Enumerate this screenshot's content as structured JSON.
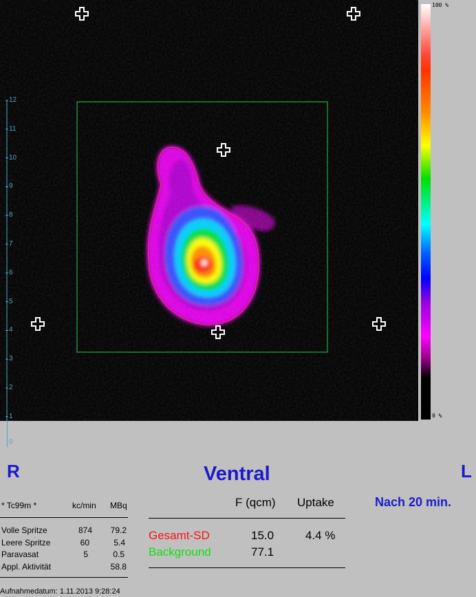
{
  "view": {
    "label": "Ventral",
    "left_label": "R",
    "right_label": "L",
    "time_note": "Nach 20 min."
  },
  "colorbar": {
    "top_label": "100 %",
    "bottom_label": "0 %"
  },
  "axis": {
    "ticks": [
      "12",
      "11",
      "10",
      "9",
      "8",
      "7",
      "6",
      "5",
      "4",
      "3",
      "2",
      "1",
      "0"
    ]
  },
  "activity_table": {
    "header": {
      "isotope": "*  Tc99m  *",
      "col1": "kc/min",
      "col2": "MBq"
    },
    "rows": [
      {
        "label": "Volle Spritze",
        "kcmin": "874",
        "mbq": "79.2"
      },
      {
        "label": "Leere Spritze",
        "kcmin": "60",
        "mbq": "5.4"
      },
      {
        "label": "Paravasat",
        "kcmin": "5",
        "mbq": "0.5"
      },
      {
        "label": "Appl. Aktivität",
        "kcmin": "",
        "mbq": "58.8"
      }
    ],
    "date_line": "Aufnahmedatum:  1.11.2013   9:28:24"
  },
  "roi_table": {
    "header": {
      "area": "F (qcm)",
      "uptake": "Uptake"
    },
    "rows": [
      {
        "label": "Gesamt-SD",
        "area": "15.0",
        "uptake": "4.4 %",
        "color": "#ff1010"
      },
      {
        "label": "Background",
        "area": "77.1",
        "uptake": "",
        "color": "#10e010"
      }
    ]
  },
  "colors": {
    "accent": "#1a1acc",
    "roi_box": "#22cc44",
    "axis": "#4aa8c8"
  }
}
